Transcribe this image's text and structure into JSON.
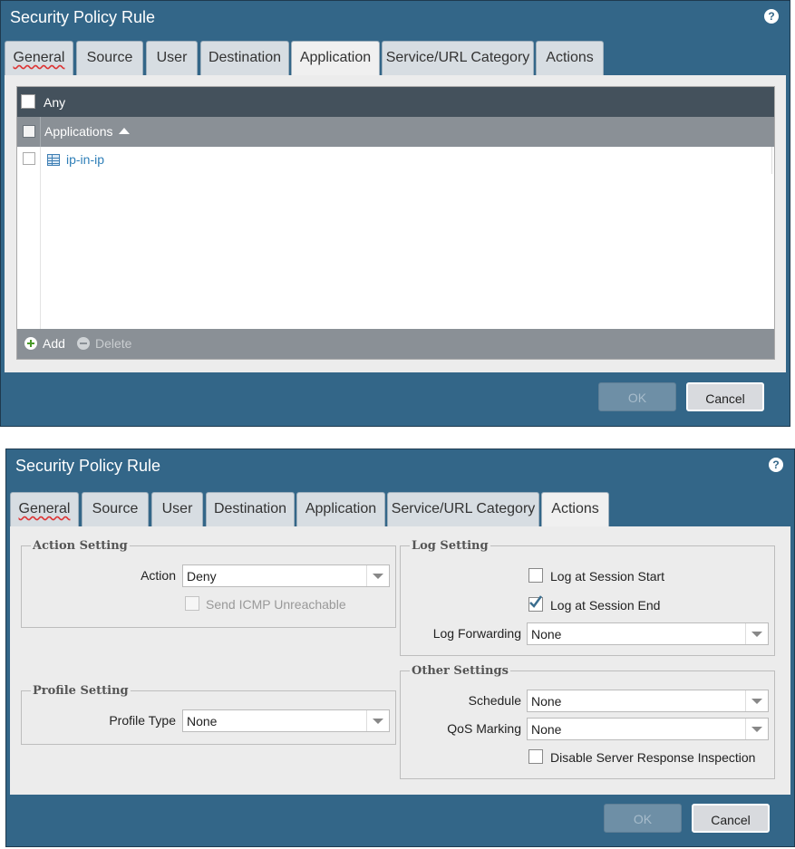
{
  "dialog1": {
    "title": "Security Policy Rule",
    "tabs": [
      "General",
      "Source",
      "User",
      "Destination",
      "Application",
      "Service/URL Category",
      "Actions"
    ],
    "active_tab": "Application",
    "any_label": "Any",
    "column_header": "Applications",
    "rows": [
      {
        "name": "ip-in-ip"
      }
    ],
    "add_label": "Add",
    "delete_label": "Delete",
    "ok_label": "OK",
    "cancel_label": "Cancel"
  },
  "dialog2": {
    "title": "Security Policy Rule",
    "tabs": [
      "General",
      "Source",
      "User",
      "Destination",
      "Application",
      "Service/URL Category",
      "Actions"
    ],
    "active_tab": "Actions",
    "action_setting": {
      "legend": "Action Setting",
      "action_label": "Action",
      "action_value": "Deny",
      "send_icmp_label": "Send ICMP Unreachable",
      "send_icmp_checked": false
    },
    "profile_setting": {
      "legend": "Profile Setting",
      "profile_type_label": "Profile Type",
      "profile_type_value": "None"
    },
    "log_setting": {
      "legend": "Log Setting",
      "log_start_label": "Log at Session Start",
      "log_start_checked": false,
      "log_end_label": "Log at Session End",
      "log_end_checked": true,
      "log_forwarding_label": "Log Forwarding",
      "log_forwarding_value": "None"
    },
    "other_settings": {
      "legend": "Other Settings",
      "schedule_label": "Schedule",
      "schedule_value": "None",
      "qos_label": "QoS Marking",
      "qos_value": "None",
      "disable_sri_label": "Disable Server Response Inspection",
      "disable_sri_checked": false
    },
    "ok_label": "OK",
    "cancel_label": "Cancel"
  },
  "colors": {
    "dialog_bg": "#336688",
    "header_dark": "#44515c",
    "header_grey": "#8a9096",
    "link": "#2f7fb8"
  }
}
